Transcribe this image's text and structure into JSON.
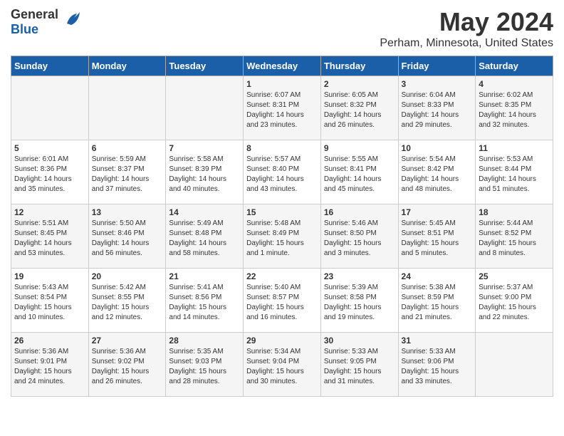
{
  "header": {
    "logo_general": "General",
    "logo_blue": "Blue",
    "title": "May 2024",
    "subtitle": "Perham, Minnesota, United States"
  },
  "days_of_week": [
    "Sunday",
    "Monday",
    "Tuesday",
    "Wednesday",
    "Thursday",
    "Friday",
    "Saturday"
  ],
  "weeks": [
    [
      {
        "day": "",
        "content": ""
      },
      {
        "day": "",
        "content": ""
      },
      {
        "day": "",
        "content": ""
      },
      {
        "day": "1",
        "content": "Sunrise: 6:07 AM\nSunset: 8:31 PM\nDaylight: 14 hours\nand 23 minutes."
      },
      {
        "day": "2",
        "content": "Sunrise: 6:05 AM\nSunset: 8:32 PM\nDaylight: 14 hours\nand 26 minutes."
      },
      {
        "day": "3",
        "content": "Sunrise: 6:04 AM\nSunset: 8:33 PM\nDaylight: 14 hours\nand 29 minutes."
      },
      {
        "day": "4",
        "content": "Sunrise: 6:02 AM\nSunset: 8:35 PM\nDaylight: 14 hours\nand 32 minutes."
      }
    ],
    [
      {
        "day": "5",
        "content": "Sunrise: 6:01 AM\nSunset: 8:36 PM\nDaylight: 14 hours\nand 35 minutes."
      },
      {
        "day": "6",
        "content": "Sunrise: 5:59 AM\nSunset: 8:37 PM\nDaylight: 14 hours\nand 37 minutes."
      },
      {
        "day": "7",
        "content": "Sunrise: 5:58 AM\nSunset: 8:39 PM\nDaylight: 14 hours\nand 40 minutes."
      },
      {
        "day": "8",
        "content": "Sunrise: 5:57 AM\nSunset: 8:40 PM\nDaylight: 14 hours\nand 43 minutes."
      },
      {
        "day": "9",
        "content": "Sunrise: 5:55 AM\nSunset: 8:41 PM\nDaylight: 14 hours\nand 45 minutes."
      },
      {
        "day": "10",
        "content": "Sunrise: 5:54 AM\nSunset: 8:42 PM\nDaylight: 14 hours\nand 48 minutes."
      },
      {
        "day": "11",
        "content": "Sunrise: 5:53 AM\nSunset: 8:44 PM\nDaylight: 14 hours\nand 51 minutes."
      }
    ],
    [
      {
        "day": "12",
        "content": "Sunrise: 5:51 AM\nSunset: 8:45 PM\nDaylight: 14 hours\nand 53 minutes."
      },
      {
        "day": "13",
        "content": "Sunrise: 5:50 AM\nSunset: 8:46 PM\nDaylight: 14 hours\nand 56 minutes."
      },
      {
        "day": "14",
        "content": "Sunrise: 5:49 AM\nSunset: 8:48 PM\nDaylight: 14 hours\nand 58 minutes."
      },
      {
        "day": "15",
        "content": "Sunrise: 5:48 AM\nSunset: 8:49 PM\nDaylight: 15 hours\nand 1 minute."
      },
      {
        "day": "16",
        "content": "Sunrise: 5:46 AM\nSunset: 8:50 PM\nDaylight: 15 hours\nand 3 minutes."
      },
      {
        "day": "17",
        "content": "Sunrise: 5:45 AM\nSunset: 8:51 PM\nDaylight: 15 hours\nand 5 minutes."
      },
      {
        "day": "18",
        "content": "Sunrise: 5:44 AM\nSunset: 8:52 PM\nDaylight: 15 hours\nand 8 minutes."
      }
    ],
    [
      {
        "day": "19",
        "content": "Sunrise: 5:43 AM\nSunset: 8:54 PM\nDaylight: 15 hours\nand 10 minutes."
      },
      {
        "day": "20",
        "content": "Sunrise: 5:42 AM\nSunset: 8:55 PM\nDaylight: 15 hours\nand 12 minutes."
      },
      {
        "day": "21",
        "content": "Sunrise: 5:41 AM\nSunset: 8:56 PM\nDaylight: 15 hours\nand 14 minutes."
      },
      {
        "day": "22",
        "content": "Sunrise: 5:40 AM\nSunset: 8:57 PM\nDaylight: 15 hours\nand 16 minutes."
      },
      {
        "day": "23",
        "content": "Sunrise: 5:39 AM\nSunset: 8:58 PM\nDaylight: 15 hours\nand 19 minutes."
      },
      {
        "day": "24",
        "content": "Sunrise: 5:38 AM\nSunset: 8:59 PM\nDaylight: 15 hours\nand 21 minutes."
      },
      {
        "day": "25",
        "content": "Sunrise: 5:37 AM\nSunset: 9:00 PM\nDaylight: 15 hours\nand 22 minutes."
      }
    ],
    [
      {
        "day": "26",
        "content": "Sunrise: 5:36 AM\nSunset: 9:01 PM\nDaylight: 15 hours\nand 24 minutes."
      },
      {
        "day": "27",
        "content": "Sunrise: 5:36 AM\nSunset: 9:02 PM\nDaylight: 15 hours\nand 26 minutes."
      },
      {
        "day": "28",
        "content": "Sunrise: 5:35 AM\nSunset: 9:03 PM\nDaylight: 15 hours\nand 28 minutes."
      },
      {
        "day": "29",
        "content": "Sunrise: 5:34 AM\nSunset: 9:04 PM\nDaylight: 15 hours\nand 30 minutes."
      },
      {
        "day": "30",
        "content": "Sunrise: 5:33 AM\nSunset: 9:05 PM\nDaylight: 15 hours\nand 31 minutes."
      },
      {
        "day": "31",
        "content": "Sunrise: 5:33 AM\nSunset: 9:06 PM\nDaylight: 15 hours\nand 33 minutes."
      },
      {
        "day": "",
        "content": ""
      }
    ]
  ]
}
